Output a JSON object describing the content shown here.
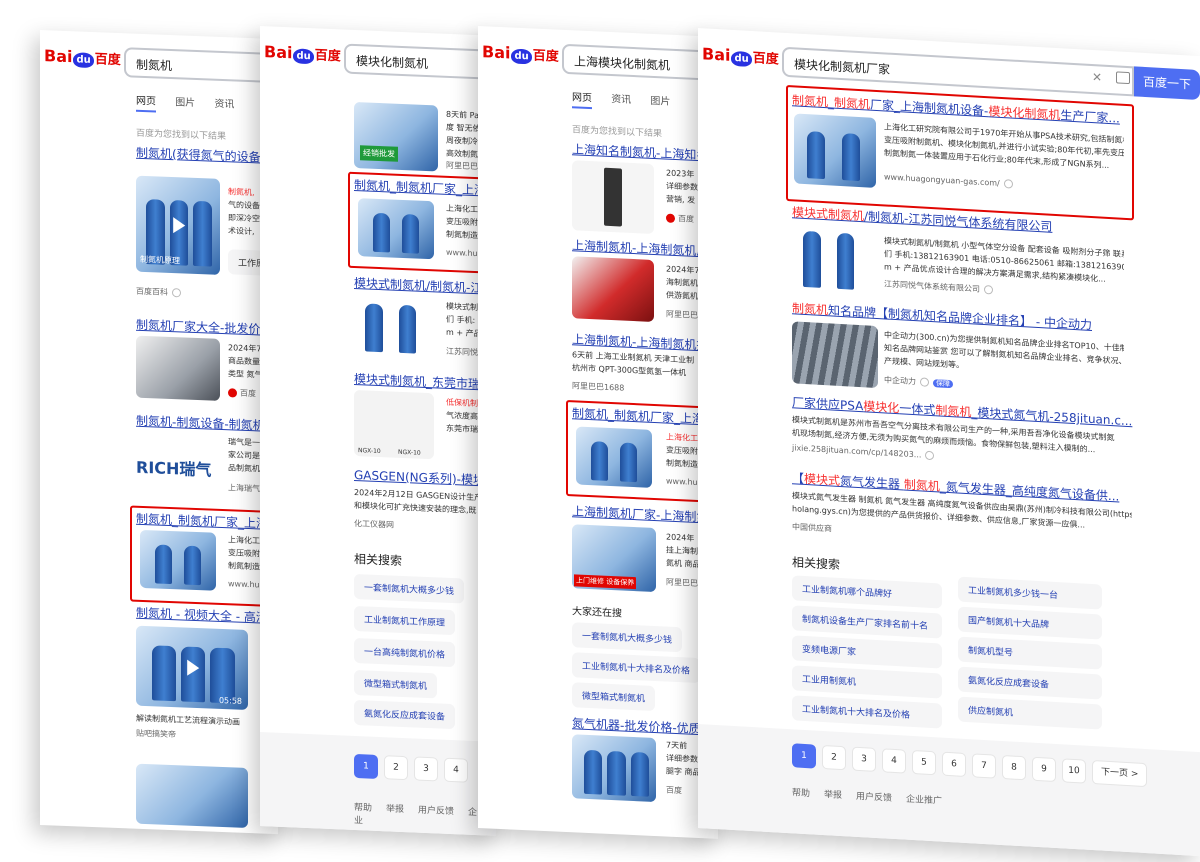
{
  "brand": {
    "logo_left": "Bai",
    "logo_du": "du",
    "logo_cn": "百度"
  },
  "cards": {
    "c1": {
      "query": "制氮机",
      "tabs": [
        "网页",
        "图片",
        "资讯"
      ],
      "found": "百度为您找到以下结果",
      "r1_title": "制氮机(获得氮气的设备",
      "r1_snip": [
        "制氮机,",
        "气的设备",
        "即深冷空",
        "术设计,"
      ],
      "r1_tag": "工作原",
      "r1_video_caption": "制氮机原理",
      "r1_src": "百度百科",
      "r2_title": "制氮机厂家大全-批发价",
      "r2_snip": [
        "2024年7",
        "商品数量",
        "类型 氮气"
      ],
      "r2_src": "百度",
      "r3_title": "制氮机-制氮设备-制氮机",
      "r3_logo": "RICH瑞气",
      "r3_snip": [
        "瑞气是一",
        "家公司是",
        "品制氮机"
      ],
      "r3_src": "上海瑞气",
      "r4_title": "制氮机_制氮机厂家_上海",
      "r4_snip": [
        "上海化工",
        "变压吸附",
        "制氮制造"
      ],
      "r4_src": "www.hua",
      "r5_title": "制氮机 - 视频大全 - 高清",
      "r5_dur": "05:58",
      "r5_caption": "解读制氮机工艺流程演示动画",
      "r5_src": "贴吧搞笑帝"
    },
    "c2": {
      "query": "模块化制氮机",
      "top_snip": [
        "8天前 Pa",
        "度 智无依",
        "周夜制冷",
        "高效制氮"
      ],
      "top_src": "阿里巴巴",
      "top_img_text": "经销批发",
      "r1_title": "制氮机_制氮机厂家_上海",
      "r1_snip": [
        "上海化工",
        "变压吸附",
        "制氮制造"
      ],
      "r1_src": "www.hua",
      "r2_title": "模块式制氮机/制氮机-江",
      "r2_snip": [
        "模块式制",
        "们 手机:",
        "m + 产品"
      ],
      "r2_src": "江苏同悦",
      "r3_title": "模块式制氮机_东莞市瑞",
      "r3_snip": [
        "低保机制",
        "气浓度高",
        "东莞市瑞"
      ],
      "r3_img_labels": [
        "NGX-10",
        "NGX-10"
      ],
      "r4_title": "GASGEN(NG系列)-模块",
      "r4_snip": "2024年2月12日 GASGEN设计生产的模块化制氮机是",
      "r4_snip2": "和模块化可扩充快速安装的理念,既",
      "r4_src": "化工仪器网",
      "related_h": "相关搜索",
      "related": [
        "一套制氮机大概多少钱",
        "工业制氮机工作原理",
        "一台高纯制氮机价格",
        "微型箱式制氮机",
        "氨氮化反应成套设备"
      ],
      "pages": [
        "1",
        "2",
        "3",
        "4"
      ],
      "footer": [
        "帮助",
        "举报",
        "用户反馈",
        "企业"
      ]
    },
    "c3": {
      "query": "上海模块化制氮机",
      "tabs": [
        "网页",
        "资讯",
        "图片"
      ],
      "found": "百度为您找到以下结果",
      "r1_title": "上海知名制氮机-上海知名",
      "r1_snip": [
        "2023年",
        "详细参数",
        "营销, 发"
      ],
      "r1_src": "百度",
      "r2_title": "上海制氮机-上海制氮机厂",
      "r2_snip": [
        "2024年7",
        "海制氮机",
        "供游氮机"
      ],
      "r2_src": "阿里巴巴",
      "r3_title": "上海制氮机-上海制氮机批",
      "r3_snip": "6天前 上海工业制氮机 天津工业制",
      "r3_snip2": "杭州市 QPT-300G型氮氢一体机",
      "r3_src": "阿里巴巴1688",
      "r4_title": "制氮机_制氮机厂家_上海",
      "r4_snip": [
        "上海化工",
        "变压吸附",
        "制氮制造"
      ],
      "r4_src": "www.hu",
      "r5_title": "上海制氮机厂家-上海制氮",
      "r5_snip": [
        "2024年",
        "挂上海制",
        "氮机 商品"
      ],
      "r5_src": "阿里巴巴",
      "r5_img_text": "上门维修 设备保养",
      "also_h": "大家还在搜",
      "also": [
        "一套制氮机大概多少钱",
        "工业制氮机十大排名及价格",
        "微型箱式制氮机"
      ],
      "r6_title": "氮气机器-批发价格-优质",
      "r6_snip": [
        "7天前",
        "详细参数",
        "腿字 商品"
      ],
      "r6_src": "百度"
    },
    "c4": {
      "query": "模块化制氮机厂家",
      "search_btn": "百度一下",
      "r1_title_parts": [
        "制氮机",
        "_",
        "制氮机",
        "厂家_上海制氮机设备-",
        "模块化制氮机",
        "生产厂家..."
      ],
      "r1_snip": [
        "上海化工研究院有限公司于1970年开始从事PSA技术研究,包括制氮机、",
        "变压吸附制氮机、模块化制氮机,并进行小试实验;80年代初,率先变压吸附",
        "制氮制氮一体装置应用于石化行业;80年代末,形成了NGN系列..."
      ],
      "r1_src": "www.huagongyuan-gas.com/",
      "r2_title_parts": [
        "模块式制氮机",
        "/制氮机-江苏同悦气体系统有限公司"
      ],
      "r2_snip": [
        "模块式制氮机/制氮机 小型气体空分设备 配套设备 吸附剂分子筛 联系我",
        "们 手机:13812163901 电话:0510-86625061 邮箱:13812163901@163.co",
        "m + 产品优点设计合理的解决方案满足需求,结构紧凑模块化..."
      ],
      "r2_src": "江苏同悦气体系统有限公司",
      "r3_title_parts": [
        "制氮机",
        "知名品牌【制氮机知名品牌企业排名】 - 中企动力"
      ],
      "r3_snip": [
        "中企动力(300.cn)为您提供制氮机知名品牌企业排名TOP10、十佳制氮机",
        "知名品牌网站鉴赏 您可以了解制氮机知名品牌企业排名、竞争状况、生",
        "产规模、网站规划等。"
      ],
      "r3_src": "中企动力",
      "r3_badge": "保障",
      "r4_title_parts": [
        "厂家供应PSA",
        "模块化",
        "一体式",
        "制氮机",
        "_模块式氮气机-258jituan.c..."
      ],
      "r4_snip": [
        "模块式制氮机是苏州市吾吾空气分离技术有限公司生产的一种,采用吾吾净化设备模块式制氮",
        "机现场制氮,经济方便,无须为购买氮气的麻烦而烦恼。食物保鲜包装,塑料注入模制的..."
      ],
      "r4_src": "jixie.258jituan.com/cp/148203...",
      "r5_title_parts": [
        "【",
        "模块式",
        "氮气发生器 ",
        "制氮机",
        "_氮气发生器_高纯度氮气设备供..."
      ],
      "r5_snip": [
        "模块式氮气发生器 制氮机 氮气发生器 高纯度氮气设备供应由吴鼎(苏州)制冷科技有限公司(https://",
        "holang.gys.cn)为您提供的产品供货报价、详细参数、供应信息,厂家货源一应俱..."
      ],
      "r5_src": "中国供应商",
      "related_h": "相关搜索",
      "related_left": [
        "工业制氮机哪个品牌好",
        "制氮机设备生产厂家排名前十名",
        "变频电源厂家",
        "工业用制氮机",
        "工业制氮机十大排名及价格"
      ],
      "related_right": [
        "工业制氮机多少钱一台",
        "国产制氮机十大品牌",
        "制氮机型号",
        "氨氮化反应成套设备",
        "供应制氮机"
      ],
      "pages": [
        "1",
        "2",
        "3",
        "4",
        "5",
        "6",
        "7",
        "8",
        "9",
        "10"
      ],
      "next": "下一页 >",
      "footer": [
        "帮助",
        "举报",
        "用户反馈",
        "企业推广"
      ]
    }
  },
  "colors": {
    "accent": "#4e6ef2",
    "link": "#2440b3",
    "highlight": "#f73131",
    "redbox": "#e10602"
  }
}
